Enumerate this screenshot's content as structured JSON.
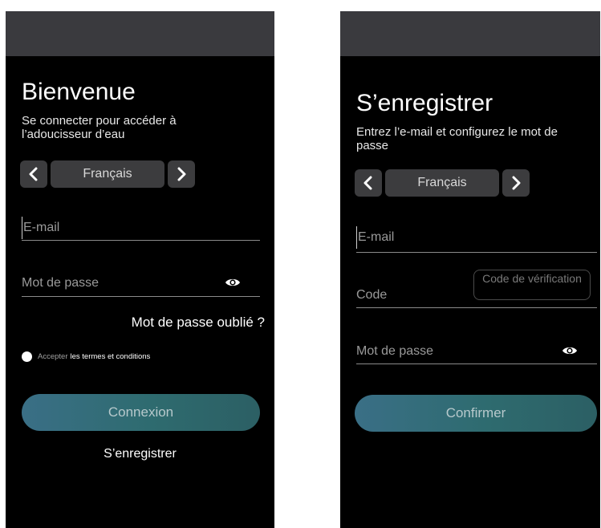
{
  "login": {
    "title": "Bienvenue",
    "subtitle": "Se connecter pour accéder à l’adoucisseur d’eau",
    "language": "Français",
    "email_placeholder": "E-mail",
    "password_placeholder": "Mot de passe",
    "forgot_password": "Mot de passe oublié ?",
    "terms_prefix": "Accepter",
    "terms_link": "les termes et conditions",
    "login_button": "Connexion",
    "register_link": "S’enregistrer"
  },
  "register": {
    "title": "S’enregistrer",
    "subtitle": "Entrez l’e-mail et configurez le mot de passe",
    "language": "Français",
    "email_placeholder": "E-mail",
    "code_placeholder": "Code",
    "code_button": "Code de vérification",
    "password_placeholder": "Mot de passe",
    "confirm_button": "Confirmer"
  },
  "colors": {
    "background": "#000000",
    "status_bar": "#3a3a3e",
    "control": "#3c3c3e",
    "button_gradient_start": "#3a6f86",
    "button_gradient_end": "#2c5f64"
  }
}
